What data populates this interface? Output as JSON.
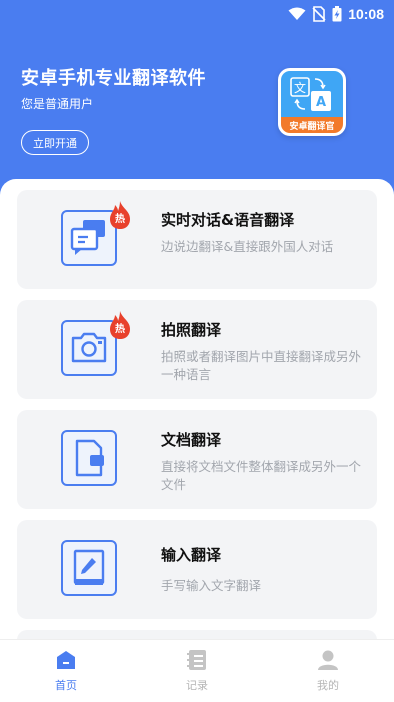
{
  "status_bar": {
    "time": "10:08"
  },
  "header": {
    "title": "安卓手机专业翻译软件",
    "user_status": "您是普通用户",
    "open_button": "立即开通",
    "logo_caption": "安卓翻译官",
    "logo_glyph_zh": "文",
    "logo_glyph_en": "A"
  },
  "features": [
    {
      "title": "实时对话&语音翻译",
      "desc": "边说边翻译&直接跟外国人对话",
      "badge": "热"
    },
    {
      "title": "拍照翻译",
      "desc": "拍照或者翻译图片中直接翻译成另外一种语言",
      "badge": "热"
    },
    {
      "title": "文档翻译",
      "desc": "直接将文档文件整体翻译成另外一个文件"
    },
    {
      "title": "输入翻译",
      "desc": "手写输入文字翻译"
    }
  ],
  "tabs": [
    {
      "label": "首页",
      "active": true
    },
    {
      "label": "记录"
    },
    {
      "label": "我的"
    }
  ],
  "colors": {
    "primary": "#4a7df0",
    "hot": "#e8412c",
    "card_bg": "#f3f4f6",
    "desc": "#a2a6ad"
  }
}
